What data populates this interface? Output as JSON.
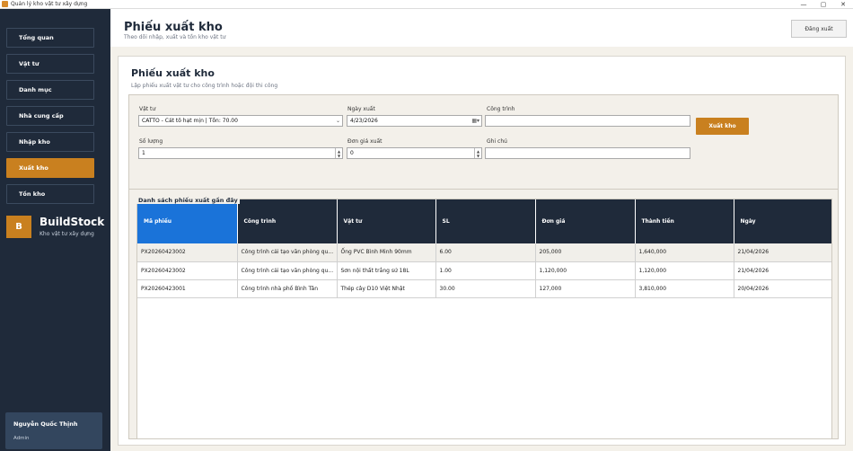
{
  "window": {
    "title": "Quản lý kho vật tư xây dựng",
    "controls": [
      "—",
      "▢",
      "✕"
    ]
  },
  "sidebar": {
    "items": [
      {
        "label": "Tổng quan",
        "active": false
      },
      {
        "label": "Vật tư",
        "active": false
      },
      {
        "label": "Danh mục",
        "active": false
      },
      {
        "label": "Nhà cung cấp",
        "active": false
      },
      {
        "label": "Nhập kho",
        "active": false
      },
      {
        "label": "Xuất kho",
        "active": true
      },
      {
        "label": "Tồn kho",
        "active": false
      }
    ],
    "brand": {
      "logo": "B",
      "name": "BuildStock",
      "subtitle": "Kho vật tư xây dựng"
    },
    "user": {
      "name": "Nguyễn Quốc Thịnh",
      "role": "Admin"
    }
  },
  "header": {
    "title": "Phiếu xuất kho",
    "subtitle": "Theo dõi nhập, xuất và tồn kho vật tư",
    "button_label": "Đăng xuất"
  },
  "panel": {
    "title": "Phiếu xuất kho",
    "subtitle": "Lập phiếu xuất vật tư cho công trình hoặc đội thi công"
  },
  "form": {
    "material_label": "Vật tư",
    "material_value": "CATTO - Cát tô hạt mịn | Tồn: 70.00",
    "date_label": "Ngày xuất",
    "date_value": "4/23/2026",
    "project_label": "Công trình",
    "project_value": "",
    "quantity_label": "Số lượng",
    "quantity_value": "1",
    "price_label": "Đơn giá xuất",
    "price_value": "0",
    "note_label": "Ghi chú",
    "note_value": "",
    "submit_label": "Xuất kho"
  },
  "table": {
    "legend": "Danh sách phiếu xuất gần đây",
    "columns": [
      "Mã phiếu",
      "Công trình",
      "Vật tư",
      "SL",
      "Đơn giá",
      "Thành tiền",
      "Ngày"
    ],
    "rows": [
      [
        "PX20260423002",
        "Công trình cải tạo văn phòng qu...",
        "Ống PVC Bình Minh 90mm",
        "6.00",
        "205,000",
        "1,640,000",
        "21/04/2026"
      ],
      [
        "PX20260423002",
        "Công trình cải tạo văn phòng qu...",
        "Sơn nội thất trắng sứ 18L",
        "1.00",
        "1,120,000",
        "1,120,000",
        "21/04/2026"
      ],
      [
        "PX20260423001",
        "Công trình nhà phố Bình Tân",
        "Thép cây D10 Việt Nhật",
        "30.00",
        "127,000",
        "3,810,000",
        "20/04/2026"
      ]
    ]
  },
  "colors": {
    "sidebar": "#1f2a3a",
    "accent": "#c9801f",
    "selected_header": "#1a73d9"
  }
}
